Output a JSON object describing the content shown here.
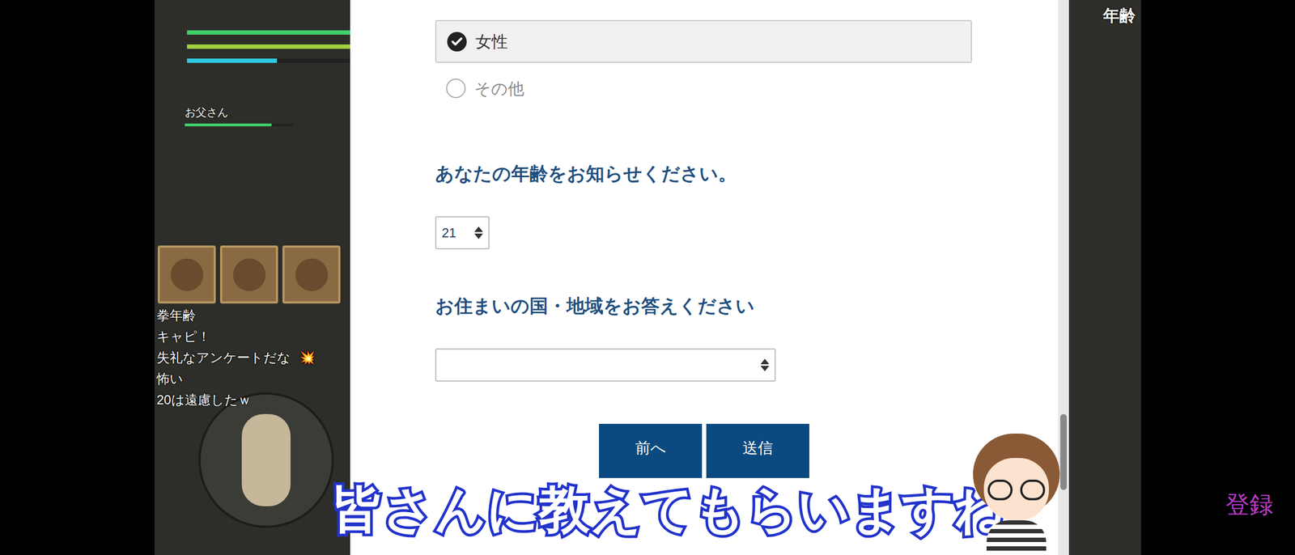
{
  "video": {
    "corner_label": "年齢",
    "register": "登録",
    "subtitle": "皆さんに教えてもらいますね"
  },
  "game_hud": {
    "bars": [
      {
        "level": 1,
        "color": "#3fd06a"
      },
      {
        "level": 1,
        "color": "#9fd040"
      },
      {
        "level": 0.55,
        "color": "#2ec8e0"
      }
    ],
    "player": {
      "name": "お父さん",
      "level": 0.8,
      "color": "#3fd06a"
    },
    "chat": [
      {
        "text": "拳年齢",
        "emoji": ""
      },
      {
        "text": "キャピ！",
        "emoji": ""
      },
      {
        "text": "失礼なアンケートだな",
        "emoji": "💥"
      },
      {
        "text": "怖い",
        "emoji": ""
      },
      {
        "text": "20は遠慮したｗ",
        "emoji": ""
      }
    ]
  },
  "form": {
    "options": [
      {
        "label": "女性",
        "selected": true
      },
      {
        "label": "その他",
        "selected": false
      }
    ],
    "questions": [
      {
        "label": "あなたの年齢をお知らせください。",
        "kind": "number",
        "value": "21"
      },
      {
        "label": "お住まいの国・地域をお答えください",
        "kind": "select",
        "value": ""
      }
    ],
    "buttons": [
      "前へ",
      "送信"
    ]
  }
}
